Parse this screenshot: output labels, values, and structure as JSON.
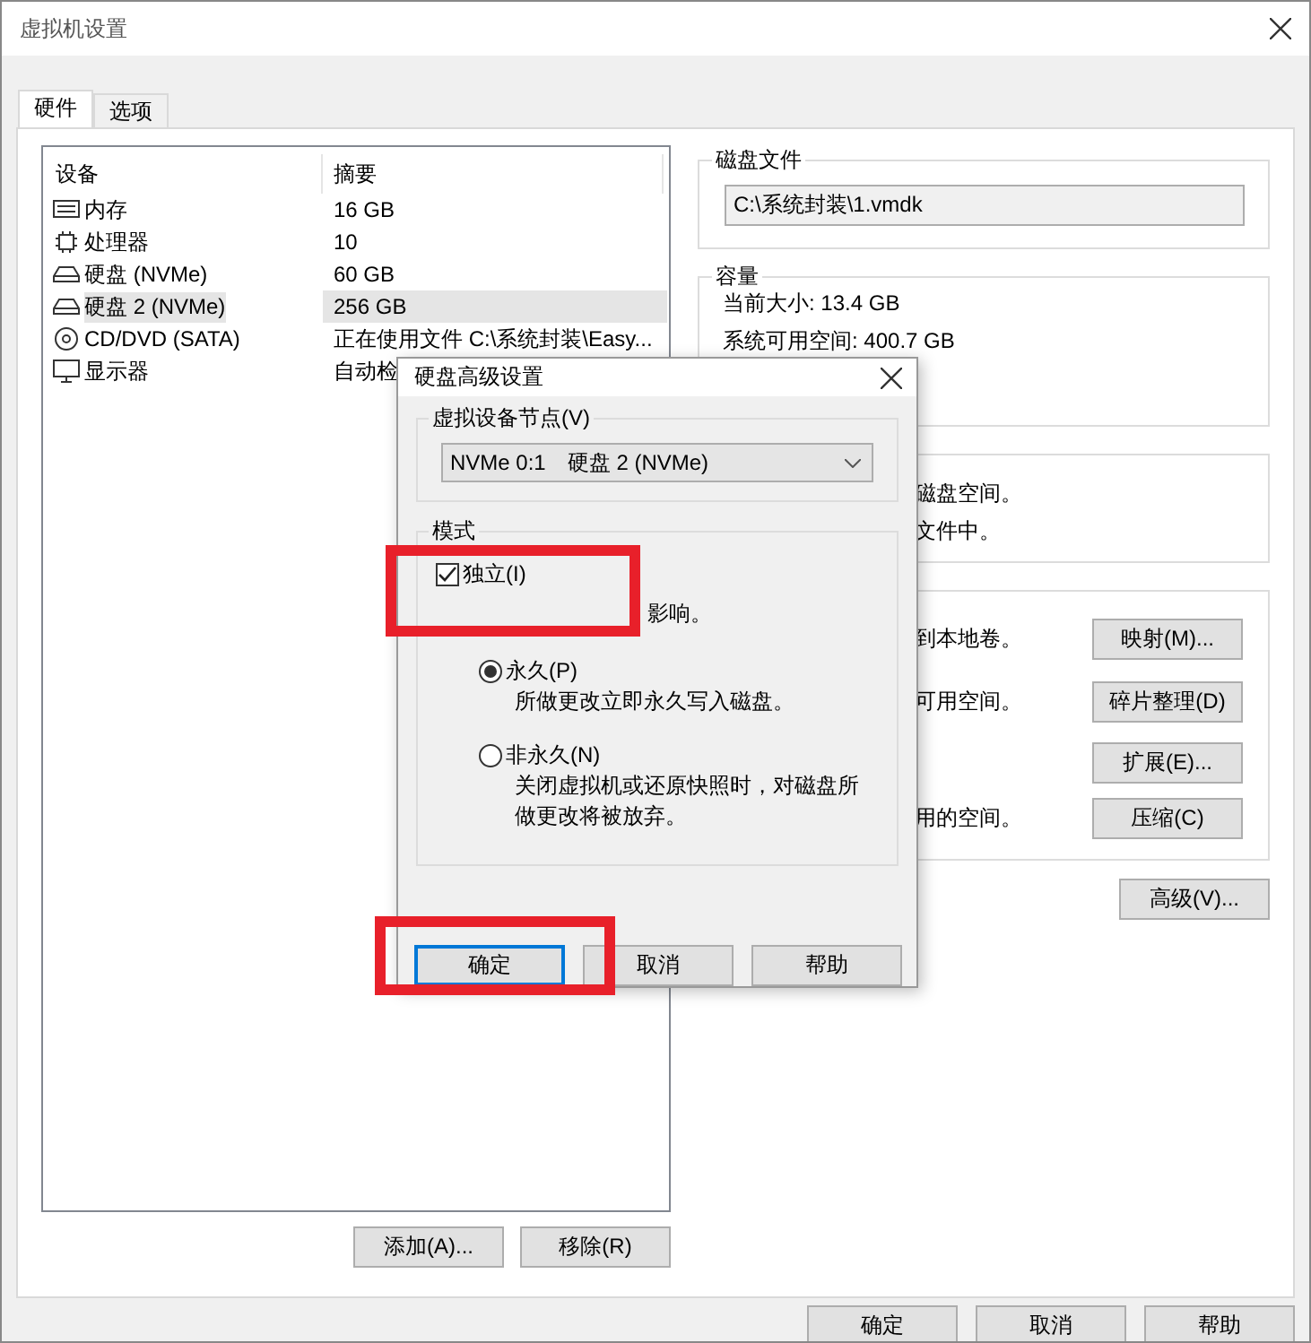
{
  "window": {
    "title": "虚拟机设置"
  },
  "tabs": [
    {
      "label": "硬件",
      "selected": true
    },
    {
      "label": "选项",
      "selected": false
    }
  ],
  "device_list": {
    "columns": [
      "设备",
      "摘要"
    ],
    "rows": [
      {
        "kind": "memory",
        "device": "内存",
        "summary": "16 GB",
        "selected": false
      },
      {
        "kind": "cpu",
        "device": "处理器",
        "summary": "10",
        "selected": false
      },
      {
        "kind": "disk",
        "device": "硬盘 (NVMe)",
        "summary": "60 GB",
        "selected": false
      },
      {
        "kind": "disk",
        "device": "硬盘 2 (NVMe)",
        "summary": "256 GB",
        "selected": true
      },
      {
        "kind": "cd",
        "device": "CD/DVD (SATA)",
        "summary": "正在使用文件 C:\\系统封装\\Easy...",
        "selected": false
      },
      {
        "kind": "display",
        "device": "显示器",
        "summary": "自动检",
        "selected": false
      }
    ]
  },
  "list_buttons": [
    "添加(A)...",
    "移除(R)"
  ],
  "disk_file": {
    "title": "磁盘文件",
    "value": "C:\\系统封装\\1.vmdk"
  },
  "capacity": {
    "title": "容量",
    "lines": [
      "当前大小: 13.4 GB",
      "系统可用空间: 400.7 GB"
    ]
  },
  "info_group": {
    "lines": [
      "磁盘空间。",
      "文件中。"
    ]
  },
  "utilities": {
    "rows": [
      {
        "text": "到本地卷。",
        "button": "映射(M)..."
      },
      {
        "text": "可用空间。",
        "button": "碎片整理(D)"
      },
      {
        "button": "扩展(E)..."
      },
      {
        "text": "用的空间。",
        "button": "压缩(C)"
      }
    ]
  },
  "advanced_button": "高级(V)...",
  "dialog": {
    "title": "硬盘高级设置",
    "node_group": {
      "title": "虚拟设备节点(V)",
      "value": "NVMe 0:1　硬盘 2 (NVMe)"
    },
    "mode_group": {
      "title": "模式",
      "independent": {
        "label": "独立(I)",
        "checked": true,
        "description": "影响。"
      },
      "options": [
        {
          "label": "永久(P)",
          "selected": true,
          "description": "所做更改立即永久写入磁盘。"
        },
        {
          "label": "非永久(N)",
          "selected": false,
          "description": "关闭虚拟机或还原快照时，对磁盘所做更改将被放弃。"
        }
      ]
    },
    "buttons": [
      {
        "label": "确定",
        "focused": true
      },
      {
        "label": "取消",
        "focused": false
      },
      {
        "label": "帮助",
        "focused": false
      }
    ]
  },
  "buttons": [
    "确定",
    "取消",
    "帮助"
  ]
}
